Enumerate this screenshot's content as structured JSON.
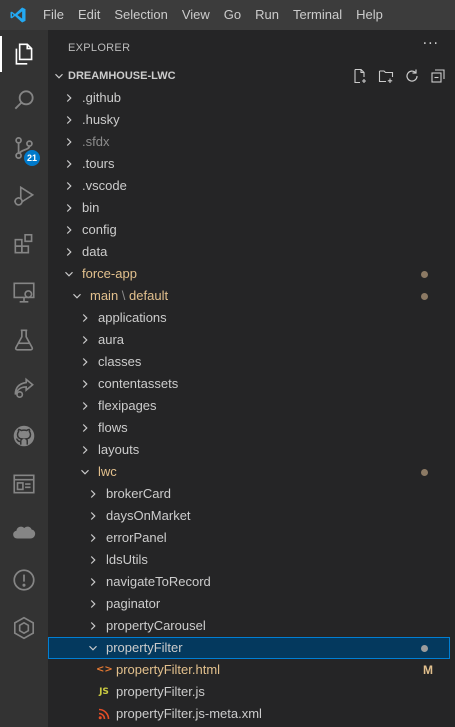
{
  "menu": [
    "File",
    "Edit",
    "Selection",
    "View",
    "Go",
    "Run",
    "Terminal",
    "Help"
  ],
  "colors": {
    "accent": "#007acc",
    "modified": "#e2c08d",
    "dot": "#8c7a64",
    "html_icon": "#e37933",
    "js_icon": "#cbcb41",
    "xml_icon": "#e44d26"
  },
  "activity": {
    "items": [
      {
        "icon": "files-icon"
      },
      {
        "icon": "search-icon"
      },
      {
        "icon": "source-control-icon",
        "badge": "21"
      },
      {
        "icon": "run-debug-icon"
      },
      {
        "icon": "extensions-icon"
      },
      {
        "icon": "remote-explorer-icon"
      },
      {
        "icon": "testing-icon"
      },
      {
        "icon": "live-share-icon"
      },
      {
        "icon": "github-icon"
      },
      {
        "icon": "browser-preview-icon"
      },
      {
        "icon": "salesforce-icon"
      },
      {
        "icon": "info-icon"
      },
      {
        "icon": "cube-icon"
      }
    ]
  },
  "explorer": {
    "title": "EXPLORER",
    "more": "···",
    "section_title": "DREAMHOUSE-LWC"
  },
  "tree": [
    {
      "label": ".github",
      "depth": 0,
      "type": "folder",
      "state": "collapsed"
    },
    {
      "label": ".husky",
      "depth": 0,
      "type": "folder",
      "state": "collapsed"
    },
    {
      "label": ".sfdx",
      "depth": 0,
      "type": "folder",
      "state": "collapsed",
      "dim": true
    },
    {
      "label": ".tours",
      "depth": 0,
      "type": "folder",
      "state": "collapsed"
    },
    {
      "label": ".vscode",
      "depth": 0,
      "type": "folder",
      "state": "collapsed"
    },
    {
      "label": "bin",
      "depth": 0,
      "type": "folder",
      "state": "collapsed"
    },
    {
      "label": "config",
      "depth": 0,
      "type": "folder",
      "state": "collapsed"
    },
    {
      "label": "data",
      "depth": 0,
      "type": "folder",
      "state": "collapsed"
    },
    {
      "label": "force-app",
      "depth": 0,
      "type": "folder",
      "state": "expanded",
      "modified": true,
      "dot": true
    },
    {
      "label": "main",
      "label2": "default",
      "depth": 1,
      "type": "folder",
      "state": "expanded",
      "modified": true,
      "dot": true
    },
    {
      "label": "applications",
      "depth": 2,
      "type": "folder",
      "state": "collapsed"
    },
    {
      "label": "aura",
      "depth": 2,
      "type": "folder",
      "state": "collapsed"
    },
    {
      "label": "classes",
      "depth": 2,
      "type": "folder",
      "state": "collapsed"
    },
    {
      "label": "contentassets",
      "depth": 2,
      "type": "folder",
      "state": "collapsed"
    },
    {
      "label": "flexipages",
      "depth": 2,
      "type": "folder",
      "state": "collapsed"
    },
    {
      "label": "flows",
      "depth": 2,
      "type": "folder",
      "state": "collapsed"
    },
    {
      "label": "layouts",
      "depth": 2,
      "type": "folder",
      "state": "collapsed"
    },
    {
      "label": "lwc",
      "depth": 2,
      "type": "folder",
      "state": "expanded",
      "modified": true,
      "dot": true
    },
    {
      "label": "brokerCard",
      "depth": 3,
      "type": "folder",
      "state": "collapsed"
    },
    {
      "label": "daysOnMarket",
      "depth": 3,
      "type": "folder",
      "state": "collapsed"
    },
    {
      "label": "errorPanel",
      "depth": 3,
      "type": "folder",
      "state": "collapsed"
    },
    {
      "label": "ldsUtils",
      "depth": 3,
      "type": "folder",
      "state": "collapsed"
    },
    {
      "label": "navigateToRecord",
      "depth": 3,
      "type": "folder",
      "state": "collapsed"
    },
    {
      "label": "paginator",
      "depth": 3,
      "type": "folder",
      "state": "collapsed"
    },
    {
      "label": "propertyCarousel",
      "depth": 3,
      "type": "folder",
      "state": "collapsed"
    },
    {
      "label": "propertyFilter",
      "depth": 3,
      "type": "folder",
      "state": "expanded",
      "selected": true,
      "dot": true
    },
    {
      "label": "propertyFilter.html",
      "depth": 4,
      "type": "html",
      "glyph": "<>",
      "modified": true,
      "flag": "M"
    },
    {
      "label": "propertyFilter.js",
      "depth": 4,
      "type": "js",
      "glyph": "JS"
    },
    {
      "label": "propertyFilter.js-meta.xml",
      "depth": 4,
      "type": "xml",
      "glyph": ""
    }
  ]
}
